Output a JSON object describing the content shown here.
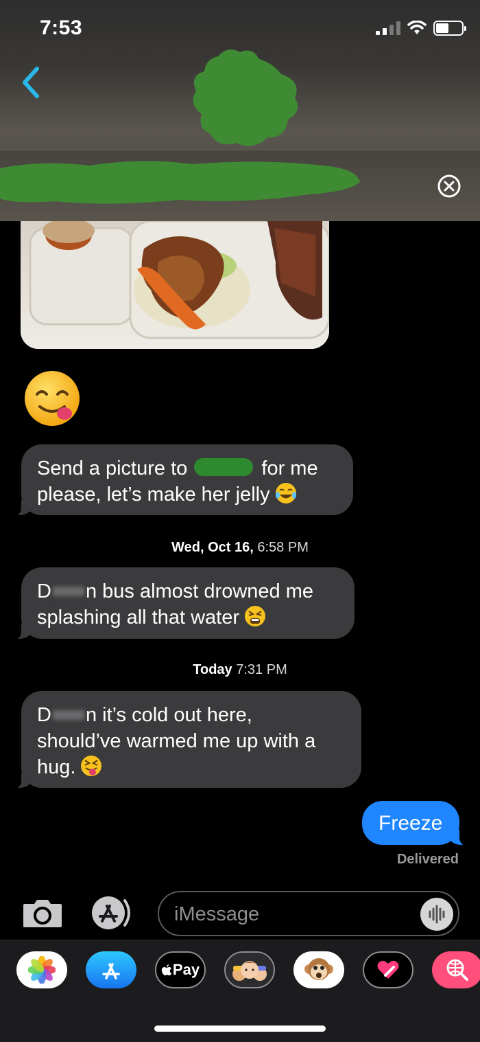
{
  "status_bar": {
    "time": "7:53"
  },
  "messages": [
    {
      "type": "received",
      "parts": [
        "Send a picture to ",
        "[redacted]",
        " for me please, let’s make her jelly",
        "😂"
      ]
    },
    {
      "type": "timestamp",
      "day": "Wed, Oct 16,",
      "time": "6:58 PM"
    },
    {
      "type": "received",
      "parts": [
        "D",
        "[blurred]",
        "n bus almost drowned me splashing all that water",
        "😫"
      ]
    },
    {
      "type": "timestamp",
      "day": "Today",
      "time": "7:31 PM"
    },
    {
      "type": "received",
      "parts": [
        "D",
        "[blurred]",
        "n it’s cold out here, should’ve warmed me up with a hug.",
        "😝"
      ]
    },
    {
      "type": "sent",
      "text": "Freeze"
    }
  ],
  "text": {
    "m1_a": "Send a picture to ",
    "m1_b": " for me",
    "m1_c": "please, let’s make her jelly",
    "ts1_day": "Wed, Oct 16,",
    "ts1_time": "6:58 PM",
    "m2_a": "D",
    "m2_b": "n bus almost drowned me",
    "m2_c": "splashing all that water",
    "ts2_day": "Today",
    "ts2_time": "7:31 PM",
    "m3_a": "D",
    "m3_b": "n it’s cold out here,",
    "m3_c": "should’ve warmed me up with a",
    "m3_d": "hug.",
    "sent": "Freeze",
    "delivered": "Delivered"
  },
  "input": {
    "placeholder": "iMessage"
  },
  "app_drawer": {
    "items": [
      "photos-app",
      "app-store",
      "apple-pay",
      "memoji",
      "animoji",
      "digital-touch",
      "web-search"
    ],
    "apple_pay_label": "Pay"
  },
  "colors": {
    "sent_bubble": "#1f86ff",
    "received_bubble": "#3b3b3d",
    "accent_back": "#2ab8e8",
    "redaction": "#2e8a2e"
  }
}
